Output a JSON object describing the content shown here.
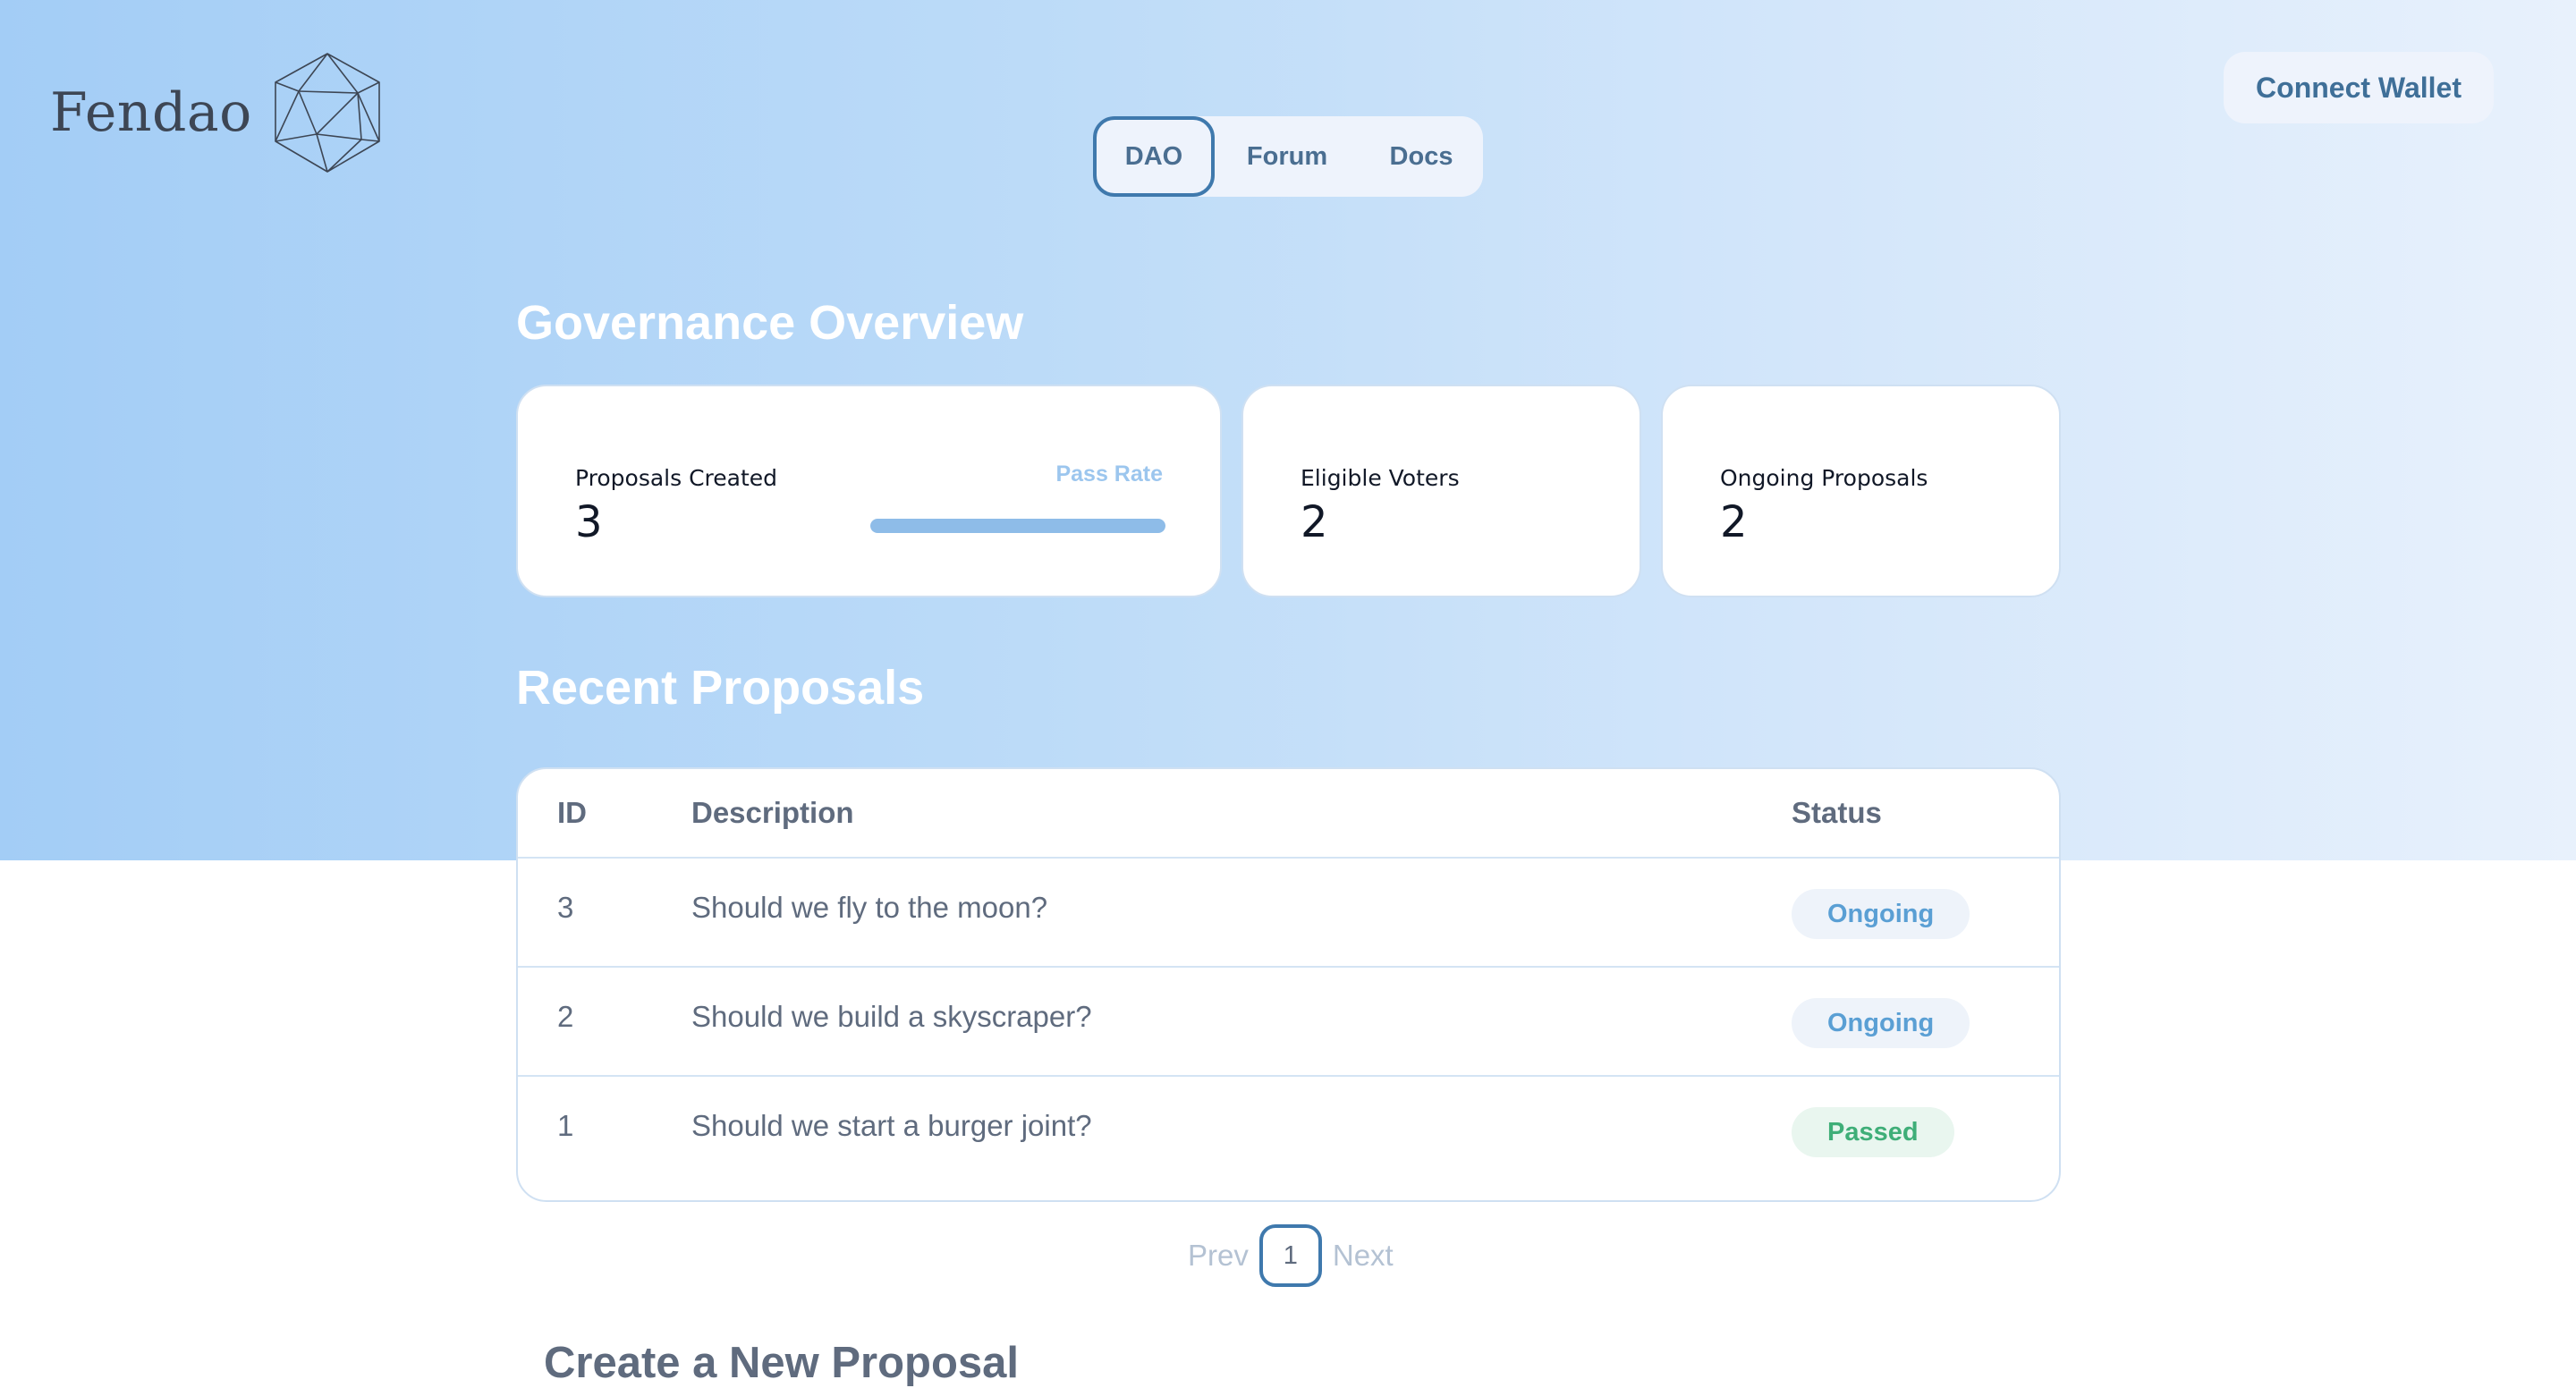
{
  "header": {
    "logo_text": "Fendao",
    "nav": {
      "tabs": [
        {
          "label": "DAO",
          "active": true
        },
        {
          "label": "Forum",
          "active": false
        },
        {
          "label": "Docs",
          "active": false
        }
      ]
    },
    "connect_label": "Connect Wallet"
  },
  "overview": {
    "title": "Governance Overview",
    "cards": {
      "proposals_created": {
        "label": "Proposals Created",
        "value": "3"
      },
      "pass_rate": {
        "label": "Pass Rate",
        "fraction": 1.0
      },
      "eligible_voters": {
        "label": "Eligible Voters",
        "value": "2"
      },
      "ongoing_proposals": {
        "label": "Ongoing Proposals",
        "value": "2"
      }
    }
  },
  "recent": {
    "title": "Recent Proposals",
    "columns": {
      "id": "ID",
      "description": "Description",
      "status": "Status"
    },
    "rows": [
      {
        "id": "3",
        "description": "Should we fly to the moon?",
        "status": "Ongoing"
      },
      {
        "id": "2",
        "description": "Should we build a skyscraper?",
        "status": "Ongoing"
      },
      {
        "id": "1",
        "description": "Should we start a burger joint?",
        "status": "Passed"
      }
    ],
    "pagination": {
      "prev": "Prev",
      "page": "1",
      "next": "Next"
    }
  },
  "create": {
    "title": "Create a New Proposal"
  },
  "colors": {
    "accent": "#3f79ad",
    "ongoing": "#5a9fd4",
    "passed": "#3fae78"
  },
  "icons": {
    "logo": "icosahedron-logo-icon"
  }
}
